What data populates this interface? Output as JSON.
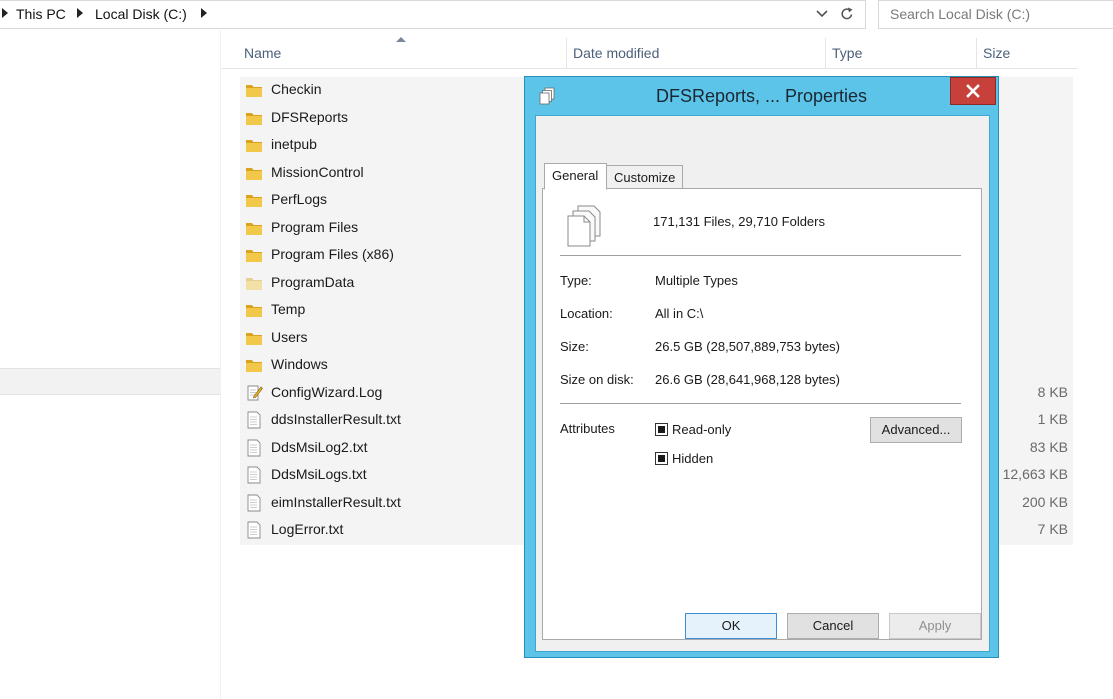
{
  "address_bar": {
    "breadcrumbs": [
      "This PC",
      "Local Disk (C:)"
    ]
  },
  "search": {
    "placeholder": "Search Local Disk (C:)"
  },
  "columns": {
    "name": "Name",
    "date_modified": "Date modified",
    "type": "Type",
    "size": "Size"
  },
  "files": [
    {
      "name": "Checkin",
      "kind": "folder",
      "size": ""
    },
    {
      "name": "DFSReports",
      "kind": "folder",
      "size": ""
    },
    {
      "name": "inetpub",
      "kind": "folder",
      "size": ""
    },
    {
      "name": "MissionControl",
      "kind": "folder",
      "size": ""
    },
    {
      "name": "PerfLogs",
      "kind": "folder",
      "size": ""
    },
    {
      "name": "Program Files",
      "kind": "folder",
      "size": ""
    },
    {
      "name": "Program Files (x86)",
      "kind": "folder",
      "size": ""
    },
    {
      "name": "ProgramData",
      "kind": "folder-hidden",
      "size": ""
    },
    {
      "name": "Temp",
      "kind": "folder",
      "size": ""
    },
    {
      "name": "Users",
      "kind": "folder",
      "size": ""
    },
    {
      "name": "Windows",
      "kind": "folder",
      "size": ""
    },
    {
      "name": "ConfigWizard.Log",
      "kind": "log",
      "size": "8 KB"
    },
    {
      "name": "ddsInstallerResult.txt",
      "kind": "text",
      "size": "1 KB"
    },
    {
      "name": "DdsMsiLog2.txt",
      "kind": "text",
      "size": "83 KB"
    },
    {
      "name": "DdsMsiLogs.txt",
      "kind": "text",
      "size": "12,663 KB"
    },
    {
      "name": "eimInstallerResult.txt",
      "kind": "text",
      "size": "200 KB"
    },
    {
      "name": "LogError.txt",
      "kind": "text",
      "size": "7 KB"
    }
  ],
  "dialog": {
    "title": "DFSReports, ... Properties",
    "close_icon": "close-icon",
    "tabs": {
      "general": "General",
      "customize": "Customize"
    },
    "summary": "171,131 Files, 29,710 Folders",
    "fields": {
      "type_label": "Type:",
      "type_value": "Multiple Types",
      "location_label": "Location:",
      "location_value": "All in C:\\",
      "size_label": "Size:",
      "size_value": "26.5 GB (28,507,889,753 bytes)",
      "size_on_disk_label": "Size on disk:",
      "size_on_disk_value": "26.6 GB (28,641,968,128 bytes)"
    },
    "attributes": {
      "label": "Attributes",
      "readonly": "Read-only",
      "hidden": "Hidden",
      "advanced_button": "Advanced..."
    },
    "buttons": {
      "ok": "OK",
      "cancel": "Cancel",
      "apply": "Apply"
    }
  },
  "colors": {
    "dialog_frame": "#5cc4e8",
    "close_button": "#c7403a",
    "folder": "#e8b830",
    "column_header_text": "#4c607a"
  }
}
